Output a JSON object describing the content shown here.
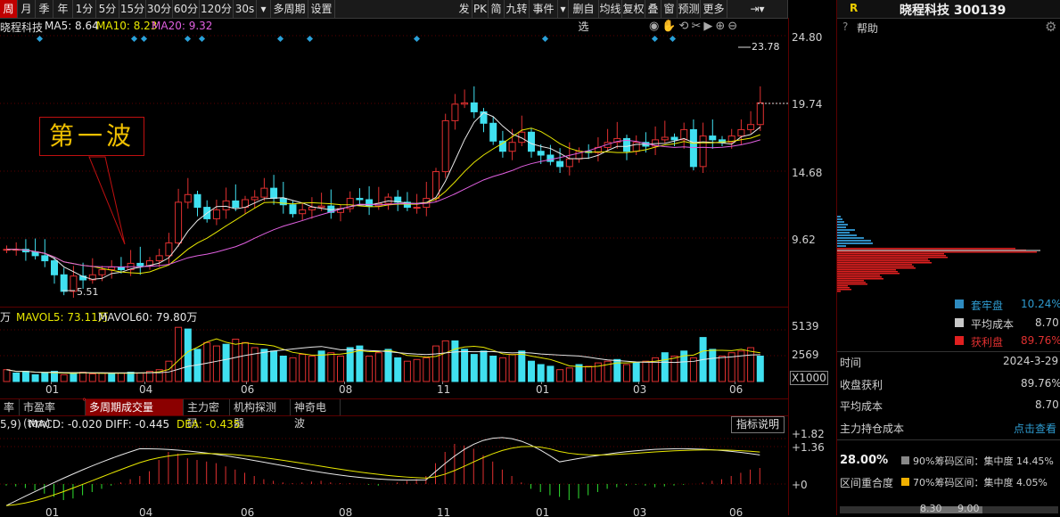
{
  "toolbar": {
    "periods": [
      "周",
      "月",
      "季",
      "年",
      "1分",
      "5分",
      "15分",
      "30分",
      "60分",
      "120分",
      "30s"
    ],
    "period_dropdown": "▾",
    "multi_period": "多周期",
    "settings": "设置",
    "right_buttons": [
      "发",
      "PK",
      "简",
      "九转",
      "事件",
      "▾",
      "删自选",
      "均线",
      "复权",
      "叠",
      "窗",
      "预测",
      "更多"
    ],
    "active": "周"
  },
  "info_bar": {
    "stock_name": "晓程科技",
    "ma5": "MA5: 8.64",
    "ma10": "MA10: 8.23",
    "ma20": "MA20: 9.32"
  },
  "price_axis": [
    "24.80",
    "19.74",
    "14.68",
    "9.62"
  ],
  "annotations": {
    "high": "23.78",
    "low": "5.51",
    "callout": "第一波"
  },
  "volume": {
    "label_prefix": "万",
    "mavol5": "MAVOL5: 73.11万",
    "mavol60": "MAVOL60: 79.80万",
    "axis": [
      "5139",
      "2569",
      "X1000"
    ]
  },
  "time_axis": [
    "01",
    "04",
    "06",
    "08",
    "11",
    "01",
    "03",
    "06"
  ],
  "indicator_tabs": [
    "率",
    "市盈率(ttm)",
    "多周期成交量",
    "主力密码",
    "机构探测器",
    "神奇电波"
  ],
  "indicator_tab_active": "多周期成交量",
  "indicator_tab_dot": "°",
  "macd": {
    "prefix": "5,9)",
    "macd": "MACD: -0.020",
    "diff": "DIFF: -0.445",
    "dea": "DEA: -0.435",
    "explain": "指标说明",
    "axis": [
      "+1.82",
      "+1.36",
      "+0"
    ]
  },
  "right_panel": {
    "code_letter": "R",
    "title": "晓程科技 300139",
    "help": "帮助",
    "legend": [
      {
        "label": "套牢盘",
        "value": "10.24%",
        "color": "#2e8bc0"
      },
      {
        "label": "平均成本",
        "value": "8.70",
        "color": "#c8c8c8"
      },
      {
        "label": "获利盘",
        "value": "89.76%",
        "color": "#e02020"
      }
    ],
    "rows": [
      {
        "label": "时间",
        "value": "2024-3-29"
      },
      {
        "label": "收盘获利",
        "value": "89.76%"
      },
      {
        "label": "平均成本",
        "value": "8.70"
      },
      {
        "label": "主力持仓成本",
        "value": "点击查看"
      }
    ],
    "concentration": {
      "pct": "28.00%",
      "label": "区间重合度",
      "r90": "90%筹码区间：集中度 14.45%",
      "r70": "70%筹码区间：集中度 4.05%",
      "bottom": [
        "8.30",
        "9.00"
      ]
    }
  }
}
